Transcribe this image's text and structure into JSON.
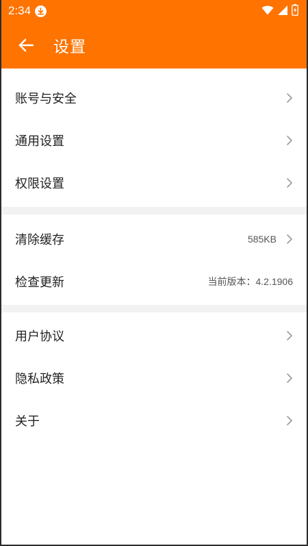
{
  "statusbar": {
    "time": "2:34"
  },
  "appbar": {
    "title": "设置"
  },
  "groups": [
    {
      "items": [
        {
          "label": "账号与安全",
          "value": ""
        },
        {
          "label": "通用设置",
          "value": ""
        },
        {
          "label": "权限设置",
          "value": ""
        }
      ]
    },
    {
      "items": [
        {
          "label": "清除缓存",
          "value": "585KB"
        },
        {
          "label": "检查更新",
          "value": "当前版本：4.2.1906"
        }
      ]
    },
    {
      "items": [
        {
          "label": "用户协议",
          "value": ""
        },
        {
          "label": "隐私政策",
          "value": ""
        },
        {
          "label": "关于",
          "value": ""
        }
      ]
    }
  ],
  "colors": {
    "accent": "#ff7300",
    "divider": "#f2f2f2",
    "text": "#222222",
    "chevron": "#9a9a9a"
  }
}
